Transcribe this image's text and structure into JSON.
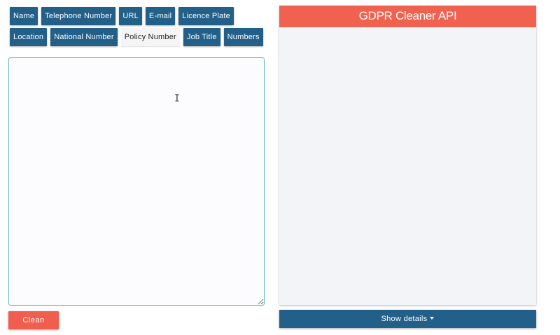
{
  "entity_tags": {
    "row1": [
      "Name",
      "Telephone Number",
      "URL",
      "E-mail",
      "Licence Plate"
    ],
    "row2": [
      "Location",
      "National Number",
      "Policy Number",
      "Job Title",
      "Numbers"
    ],
    "active": "Policy Number"
  },
  "input": {
    "value": "",
    "placeholder": ""
  },
  "clean_button": {
    "label": "Clean"
  },
  "output_panel": {
    "title": "GDPR Cleaner API",
    "content": ""
  },
  "details_button": {
    "label": "Show details"
  },
  "colors": {
    "primary": "#236089",
    "accent": "#ef5e4f",
    "panel_bg": "#f3f4f7",
    "input_border": "#5bb8c8"
  }
}
